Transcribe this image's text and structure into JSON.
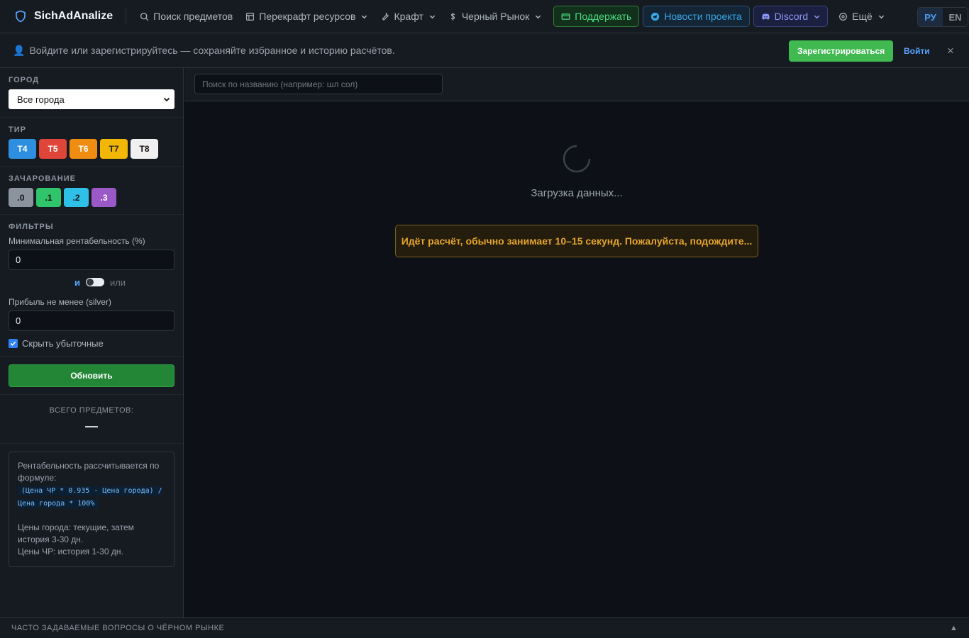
{
  "app": {
    "brand": "SichAdAnalize"
  },
  "nav": {
    "items": [
      {
        "label": "Поиск предметов",
        "icon": "search-icon"
      },
      {
        "label": "Перекрафт ресурсов",
        "icon": "table-icon"
      },
      {
        "label": "Крафт",
        "icon": "wrench-icon"
      },
      {
        "label": "Черный Рынок",
        "icon": "dollar-icon"
      }
    ],
    "support_label": "Поддержать",
    "news_label": "Новости проекта",
    "discord_label": "Discord",
    "more_label": "Ещё",
    "lang_ru": "РУ",
    "lang_en": "EN"
  },
  "banner": {
    "text": "Войдите или зарегистрируйтесь — сохраняйте избранное и историю расчётов.",
    "register_label": "Зарегистрироваться",
    "login_label": "Войти",
    "close_label": "×"
  },
  "sidebar": {
    "city": {
      "title": "ГОРОД",
      "selected": "Все города"
    },
    "tier": {
      "title": "ТИР",
      "options": [
        "T4",
        "T5",
        "T6",
        "T7",
        "T8"
      ]
    },
    "enchant": {
      "title": "ЗАЧАРОВАНИЕ",
      "options": [
        ".0",
        ".1",
        ".2",
        ".3"
      ]
    },
    "filters": {
      "title": "ФИЛЬТРЫ",
      "min_profitability_label": "Минимальная рентабельность (%)",
      "min_profitability_value": "0",
      "logic_and": "и",
      "logic_or": "или",
      "min_profit_label": "Прибыль не менее (silver)",
      "min_profit_value": "0",
      "hide_unprofitable_label": "Скрыть убыточные",
      "hide_unprofitable_checked": true
    },
    "update_label": "Обновить",
    "total_label": "ВСЕГО ПРЕДМЕТОВ:",
    "info": {
      "line1": "Рентабельность рассчитывается по формуле:",
      "formula": "(Цена ЧР * 0.935 - Цена города) / Цена города * 100%",
      "line2": "Цены города: текущие, затем история 3-30 дн.",
      "line3": "Цены ЧР: история 1-30 дн."
    }
  },
  "main": {
    "search_placeholder": "Поиск по названию (например: шл сол)",
    "loading_text": "Загрузка данных...",
    "warning_text": "Идёт расчёт, обычно занимает 10–15 секунд. Пожалуйста, подождите..."
  },
  "footer": {
    "label": "ЧАСТО ЗАДАВАЕМЫЕ ВОПРОСЫ О ЧЁРНОМ РЫНКЕ"
  },
  "colors": {
    "background": "#0d1117",
    "panel": "#161b22",
    "accent_green": "#3fb950",
    "accent_blue": "#58a6ff",
    "warning": "#e3a52b"
  }
}
